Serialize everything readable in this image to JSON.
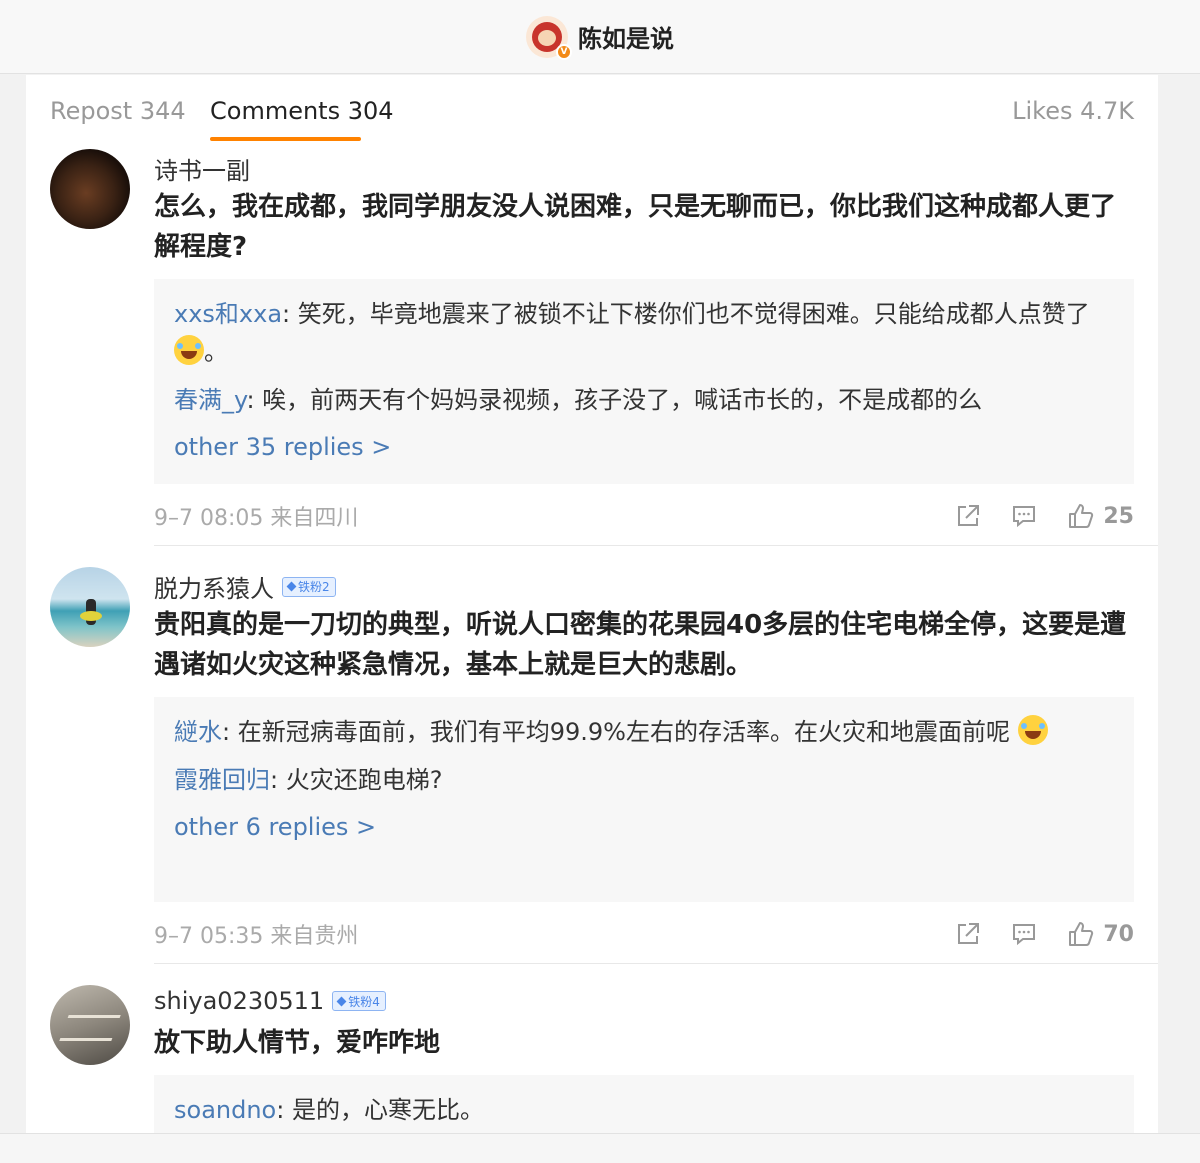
{
  "header": {
    "account_name": "陈如是说",
    "verified_mark": "V"
  },
  "tabs": {
    "repost": "Repost 344",
    "comments": "Comments 304",
    "likes": "Likes 4.7K"
  },
  "comments": [
    {
      "user": "诗书一副",
      "text": "怎么，我在成都，我同学朋友没人说困难，只是无聊而已，你比我们这种成都人更了解程度?",
      "replies": [
        {
          "user": "xxs和xxa",
          "sep": ": ",
          "text": "笑死，毕竟地震来了被锁不让下楼你们也不觉得困难。只能给成都人点赞了",
          "tail": "。"
        },
        {
          "user": "春满_y",
          "sep": ": ",
          "text": "唉，前两天有个妈妈录视频，孩子没了，喊话市长的，不是成都的么"
        }
      ],
      "more": "other 35 replies >",
      "time": "9–7 08:05  来自四川",
      "likes": "25"
    },
    {
      "user": "脱力系猿人",
      "badge": "铁粉2",
      "text": "贵阳真的是一刀切的典型，听说人口密集的花果园40多层的住宅电梯全停，这要是遭遇诸如火灾这种紧急情况，基本上就是巨大的悲剧。",
      "replies": [
        {
          "user": "縌水",
          "sep": ": ",
          "text": "在新冠病毒面前，我们有平均99.9%左右的存活率。在火灾和地震面前呢"
        },
        {
          "user": "霞雅回归",
          "sep": ": ",
          "text": "火灾还跑电梯?"
        }
      ],
      "more": "other 6 replies >",
      "time": "9–7 05:35  来自贵州",
      "likes": "70"
    },
    {
      "user": "shiya0230511",
      "badge": "铁粉4",
      "text": "放下助人情节，爱咋咋地",
      "replies": [
        {
          "user": "soandno",
          "sep": ": ",
          "text": "是的，心寒无比。"
        }
      ]
    }
  ],
  "colors": {
    "accent": "#ff8200",
    "link": "#4a7bb5"
  }
}
